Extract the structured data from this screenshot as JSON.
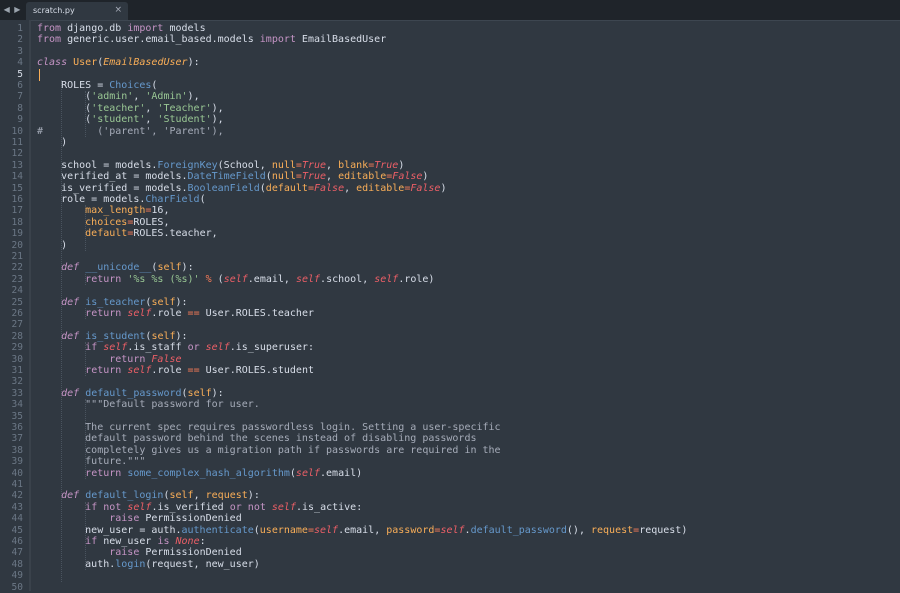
{
  "tabbar": {
    "nav_arrows": "◀ ▶",
    "tab_title": "scratch.py",
    "tab_close": "×"
  },
  "editor": {
    "active_line": 5,
    "line_numbers": [
      "1",
      "2",
      "3",
      "4",
      "5",
      "6",
      "7",
      "8",
      "9",
      "10",
      "11",
      "12",
      "13",
      "14",
      "15",
      "16",
      "17",
      "18",
      "19",
      "20",
      "21",
      "22",
      "23",
      "24",
      "25",
      "26",
      "27",
      "28",
      "29",
      "30",
      "31",
      "32",
      "33",
      "34",
      "35",
      "36",
      "37",
      "38",
      "39",
      "40",
      "41",
      "42",
      "43",
      "44",
      "45",
      "46",
      "47",
      "48",
      "49",
      "50"
    ],
    "lines": [
      [
        [
          "k",
          "from"
        ],
        [
          "p",
          " django.db "
        ],
        [
          "k",
          "import"
        ],
        [
          "p",
          " models"
        ]
      ],
      [
        [
          "k",
          "from"
        ],
        [
          "p",
          " generic.user.email_based.models "
        ],
        [
          "k",
          "import"
        ],
        [
          "p",
          " EmailBasedUser"
        ]
      ],
      [],
      [
        [
          "kf",
          "class"
        ],
        [
          "p",
          " "
        ],
        [
          "nm",
          "User"
        ],
        [
          "p",
          "("
        ],
        [
          "inh",
          "EmailBasedUser"
        ],
        [
          "p",
          "):"
        ]
      ],
      [],
      [
        [
          "p",
          "    ROLES = "
        ],
        [
          "f",
          "Choices"
        ],
        [
          "p",
          "("
        ]
      ],
      [
        [
          "p",
          "        ("
        ],
        [
          "s",
          "'admin'"
        ],
        [
          "p",
          ", "
        ],
        [
          "s",
          "'Admin'"
        ],
        [
          "p",
          "),"
        ]
      ],
      [
        [
          "p",
          "        ("
        ],
        [
          "s",
          "'teacher'"
        ],
        [
          "p",
          ", "
        ],
        [
          "s",
          "'Teacher'"
        ],
        [
          "p",
          "),"
        ]
      ],
      [
        [
          "p",
          "        ("
        ],
        [
          "s",
          "'student'"
        ],
        [
          "p",
          ", "
        ],
        [
          "s",
          "'Student'"
        ],
        [
          "p",
          "),"
        ]
      ],
      [
        [
          "c",
          "#         ('parent', 'Parent'),"
        ]
      ],
      [
        [
          "p",
          "    )"
        ]
      ],
      [],
      [
        [
          "p",
          "    school = models."
        ],
        [
          "f",
          "ForeignKey"
        ],
        [
          "p",
          "(School, "
        ],
        [
          "arg",
          "null"
        ],
        [
          "op",
          "="
        ],
        [
          "bool",
          "True"
        ],
        [
          "p",
          ", "
        ],
        [
          "arg",
          "blank"
        ],
        [
          "op",
          "="
        ],
        [
          "bool",
          "True"
        ],
        [
          "p",
          ")"
        ]
      ],
      [
        [
          "p",
          "    verified_at = models."
        ],
        [
          "f",
          "DateTimeField"
        ],
        [
          "p",
          "("
        ],
        [
          "arg",
          "null"
        ],
        [
          "op",
          "="
        ],
        [
          "bool",
          "True"
        ],
        [
          "p",
          ", "
        ],
        [
          "arg",
          "editable"
        ],
        [
          "op",
          "="
        ],
        [
          "bool",
          "False"
        ],
        [
          "p",
          ")"
        ]
      ],
      [
        [
          "p",
          "    is_verified = models."
        ],
        [
          "f",
          "BooleanField"
        ],
        [
          "p",
          "("
        ],
        [
          "arg",
          "default"
        ],
        [
          "op",
          "="
        ],
        [
          "bool",
          "False"
        ],
        [
          "p",
          ", "
        ],
        [
          "arg",
          "editable"
        ],
        [
          "op",
          "="
        ],
        [
          "bool",
          "False"
        ],
        [
          "p",
          ")"
        ]
      ],
      [
        [
          "p",
          "    role = models."
        ],
        [
          "f",
          "CharField"
        ],
        [
          "p",
          "("
        ]
      ],
      [
        [
          "arg",
          "        max_length"
        ],
        [
          "op",
          "="
        ],
        [
          "p",
          "16,"
        ]
      ],
      [
        [
          "arg",
          "        choices"
        ],
        [
          "op",
          "="
        ],
        [
          "p",
          "ROLES,"
        ]
      ],
      [
        [
          "arg",
          "        default"
        ],
        [
          "op",
          "="
        ],
        [
          "p",
          "ROLES.teacher,"
        ]
      ],
      [
        [
          "p",
          "    )"
        ]
      ],
      [],
      [
        [
          "kf",
          "    def"
        ],
        [
          "p",
          " "
        ],
        [
          "f",
          "__unicode__"
        ],
        [
          "p",
          "("
        ],
        [
          "arg",
          "self"
        ],
        [
          "p",
          "):"
        ]
      ],
      [
        [
          "p",
          "        "
        ],
        [
          "k",
          "return"
        ],
        [
          "p",
          " "
        ],
        [
          "s",
          "'%s %s (%s)'"
        ],
        [
          "p",
          " "
        ],
        [
          "op",
          "%"
        ],
        [
          "p",
          " ("
        ],
        [
          "self",
          "self"
        ],
        [
          "p",
          ".email, "
        ],
        [
          "self",
          "self"
        ],
        [
          "p",
          ".school, "
        ],
        [
          "self",
          "self"
        ],
        [
          "p",
          ".role)"
        ]
      ],
      [],
      [
        [
          "kf",
          "    def"
        ],
        [
          "p",
          " "
        ],
        [
          "f",
          "is_teacher"
        ],
        [
          "p",
          "("
        ],
        [
          "arg",
          "self"
        ],
        [
          "p",
          "):"
        ]
      ],
      [
        [
          "p",
          "        "
        ],
        [
          "k",
          "return"
        ],
        [
          "p",
          " "
        ],
        [
          "self",
          "self"
        ],
        [
          "p",
          ".role "
        ],
        [
          "op",
          "=="
        ],
        [
          "p",
          " User.ROLES.teacher"
        ]
      ],
      [],
      [
        [
          "kf",
          "    def"
        ],
        [
          "p",
          " "
        ],
        [
          "f",
          "is_student"
        ],
        [
          "p",
          "("
        ],
        [
          "arg",
          "self"
        ],
        [
          "p",
          "):"
        ]
      ],
      [
        [
          "p",
          "        "
        ],
        [
          "k",
          "if"
        ],
        [
          "p",
          " "
        ],
        [
          "self",
          "self"
        ],
        [
          "p",
          ".is_staff "
        ],
        [
          "k",
          "or"
        ],
        [
          "p",
          " "
        ],
        [
          "self",
          "self"
        ],
        [
          "p",
          ".is_superuser:"
        ]
      ],
      [
        [
          "p",
          "            "
        ],
        [
          "k",
          "return"
        ],
        [
          "p",
          " "
        ],
        [
          "bool",
          "False"
        ]
      ],
      [
        [
          "p",
          "        "
        ],
        [
          "k",
          "return"
        ],
        [
          "p",
          " "
        ],
        [
          "self",
          "self"
        ],
        [
          "p",
          ".role "
        ],
        [
          "op",
          "=="
        ],
        [
          "p",
          " User.ROLES.student"
        ]
      ],
      [],
      [
        [
          "kf",
          "    def"
        ],
        [
          "p",
          " "
        ],
        [
          "f",
          "default_password"
        ],
        [
          "p",
          "("
        ],
        [
          "arg",
          "self"
        ],
        [
          "p",
          "):"
        ]
      ],
      [
        [
          "c",
          "        \"\"\"Default password for user."
        ]
      ],
      [],
      [
        [
          "c",
          "        The current spec requires passwordless login. Setting a user-specific"
        ]
      ],
      [
        [
          "c",
          "        default password behind the scenes instead of disabling passwords"
        ]
      ],
      [
        [
          "c",
          "        completely gives us a migration path if passwords are required in the"
        ]
      ],
      [
        [
          "c",
          "        future.\"\"\""
        ]
      ],
      [
        [
          "p",
          "        "
        ],
        [
          "k",
          "return"
        ],
        [
          "p",
          " "
        ],
        [
          "f",
          "some_complex_hash_algorithm"
        ],
        [
          "p",
          "("
        ],
        [
          "self",
          "self"
        ],
        [
          "p",
          ".email)"
        ]
      ],
      [],
      [
        [
          "kf",
          "    def"
        ],
        [
          "p",
          " "
        ],
        [
          "f",
          "default_login"
        ],
        [
          "p",
          "("
        ],
        [
          "arg",
          "self"
        ],
        [
          "p",
          ", "
        ],
        [
          "arg",
          "request"
        ],
        [
          "p",
          "):"
        ]
      ],
      [
        [
          "p",
          "        "
        ],
        [
          "k",
          "if"
        ],
        [
          "p",
          " "
        ],
        [
          "k",
          "not"
        ],
        [
          "p",
          " "
        ],
        [
          "self",
          "self"
        ],
        [
          "p",
          ".is_verified "
        ],
        [
          "k",
          "or"
        ],
        [
          "p",
          " "
        ],
        [
          "k",
          "not"
        ],
        [
          "p",
          " "
        ],
        [
          "self",
          "self"
        ],
        [
          "p",
          ".is_active:"
        ]
      ],
      [
        [
          "p",
          "            "
        ],
        [
          "k",
          "raise"
        ],
        [
          "p",
          " PermissionDenied"
        ]
      ],
      [
        [
          "p",
          "        new_user = auth."
        ],
        [
          "f",
          "authenticate"
        ],
        [
          "p",
          "("
        ],
        [
          "arg",
          "username"
        ],
        [
          "op",
          "="
        ],
        [
          "self",
          "self"
        ],
        [
          "p",
          ".email, "
        ],
        [
          "arg",
          "password"
        ],
        [
          "op",
          "="
        ],
        [
          "self",
          "self"
        ],
        [
          "p",
          "."
        ],
        [
          "f",
          "default_password"
        ],
        [
          "p",
          "(), "
        ],
        [
          "arg",
          "request"
        ],
        [
          "op",
          "="
        ],
        [
          "p",
          "request)"
        ]
      ],
      [
        [
          "p",
          "        "
        ],
        [
          "k",
          "if"
        ],
        [
          "p",
          " new_user "
        ],
        [
          "k",
          "is"
        ],
        [
          "p",
          " "
        ],
        [
          "bool",
          "None"
        ],
        [
          "p",
          ":"
        ]
      ],
      [
        [
          "p",
          "            "
        ],
        [
          "k",
          "raise"
        ],
        [
          "p",
          " PermissionDenied"
        ]
      ],
      [
        [
          "p",
          "        auth."
        ],
        [
          "f",
          "login"
        ],
        [
          "p",
          "(request, new_user)"
        ]
      ],
      [],
      []
    ]
  }
}
